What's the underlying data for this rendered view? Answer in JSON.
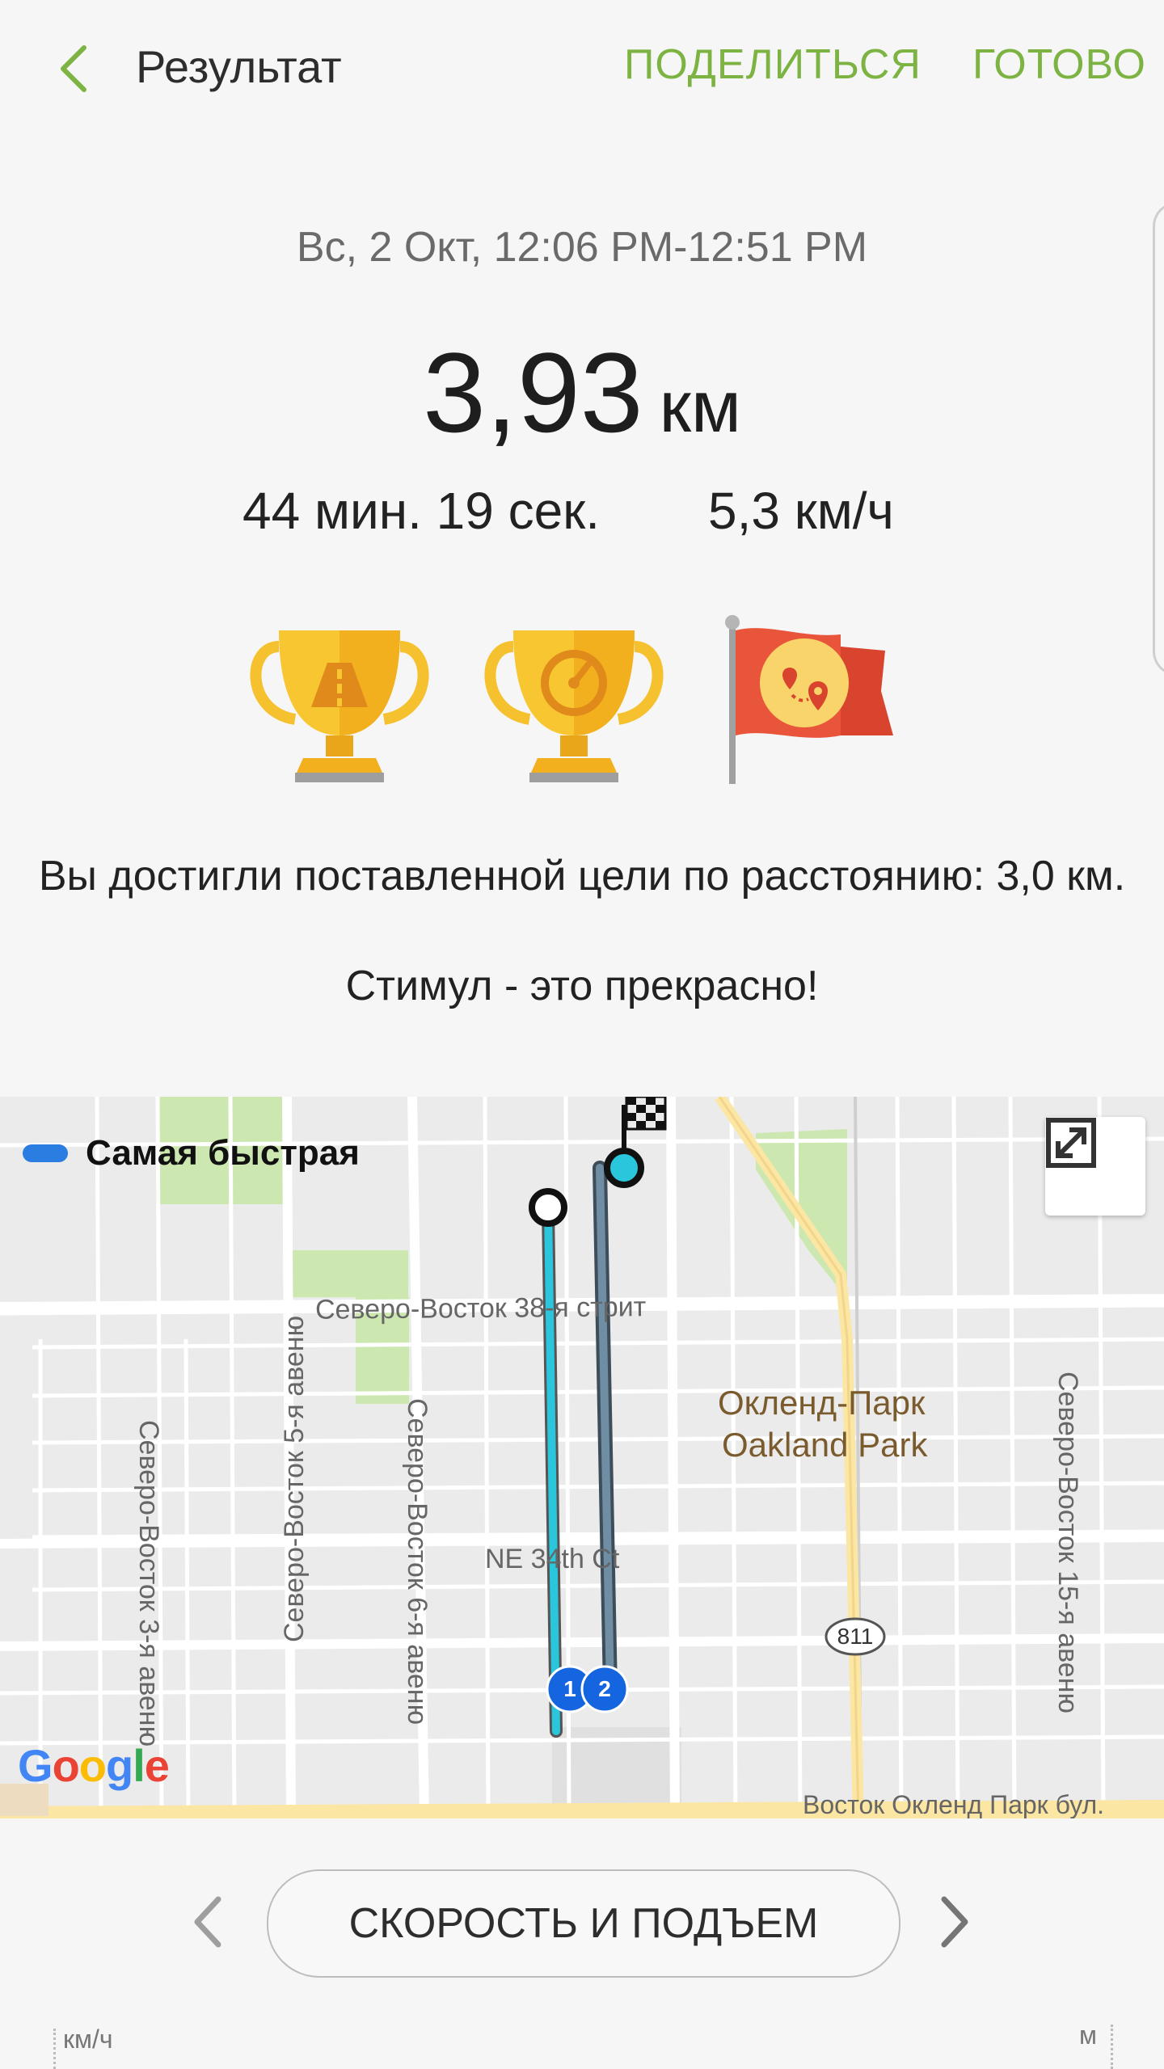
{
  "header": {
    "title": "Результат",
    "share_label": "ПОДЕЛИТЬСЯ",
    "done_label": "ГОТОВО"
  },
  "workout": {
    "datetime": "Вс, 2 Окт, 12:06 PM-12:51 PM",
    "distance_value": "3,93",
    "distance_unit": "км",
    "duration": "44 мин. 19 сек.",
    "speed": "5,3 км/ч"
  },
  "badges": [
    {
      "icon": "trophy-distance-icon"
    },
    {
      "icon": "trophy-speed-icon"
    },
    {
      "icon": "route-flag-icon"
    }
  ],
  "goal_message": "Вы достигли поставленной цели по расстоянию: 3,0 км.",
  "motivation": "Стимул - это прекрасно!",
  "map": {
    "legend_label": "Самая быстрая",
    "street_38": "Северо-Восток 38-я стрит",
    "street_3rd": "Северо-Восток 3-я авеню",
    "street_5th": "Северо-Восток 5-я авеню",
    "street_6th": "Северо-Восток 6-я авеню",
    "street_15th": "Северо-Восток 15-я авеню",
    "street_34ct": "NE 34th Ct",
    "district_ru": "Окленд-Парк",
    "district_en": "Oakland Park",
    "route_shield": "811",
    "blvd": "Восток Окленд Парк бул.",
    "marker_1": "1",
    "marker_2": "2",
    "attribution": "Google"
  },
  "bottom": {
    "tab_label": "СКОРОСТЬ И ПОДЪЕМ",
    "left_axis_unit": "км/ч",
    "right_axis_unit": "м"
  },
  "colors": {
    "accent": "#7cb342",
    "fastest_route": "#2a7de1",
    "track_current": "#29c6dc",
    "track_previous": "#6f8ea3"
  }
}
